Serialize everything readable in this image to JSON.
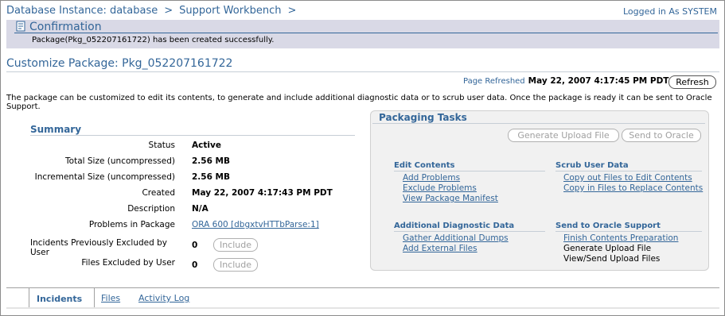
{
  "breadcrumb": {
    "items": [
      "Database Instance: database",
      "Support Workbench"
    ],
    "separator": ">"
  },
  "login_status": "Logged in As SYSTEM",
  "confirmation": {
    "title": "Confirmation",
    "message": "Package(Pkg_052207161722) has been created successfully."
  },
  "page_title": "Customize Package: Pkg_052207161722",
  "refresh": {
    "label": "Page Refreshed",
    "timestamp": "May 22, 2007 4:17:45 PM PDT",
    "button": "Refresh"
  },
  "intro_text": "The package can be customized to edit its contents, to generate and include additional diagnostic data or to scrub user data. Once the package is ready it can be sent to Oracle Support.",
  "summary": {
    "title": "Summary",
    "status": {
      "label": "Status",
      "value": "Active"
    },
    "total_size": {
      "label": "Total Size (uncompressed)",
      "value": "2.56 MB"
    },
    "incremental_size": {
      "label": "Incremental Size (uncompressed)",
      "value": "2.56 MB"
    },
    "created": {
      "label": "Created",
      "value": "May 22, 2007 4:17:43 PM PDT"
    },
    "description": {
      "label": "Description",
      "value": "N/A"
    },
    "problems": {
      "label": "Problems in Package",
      "value": "ORA 600 [dbgxtvHTTbParse:1]"
    },
    "incidents_excluded": {
      "label": "Incidents Previously Excluded by User",
      "value": "0",
      "button": "Include"
    },
    "files_excluded": {
      "label": "Files Excluded by User",
      "value": "0",
      "button": "Include"
    }
  },
  "packaging_tasks": {
    "title": "Packaging Tasks",
    "generate_button": "Generate Upload File",
    "send_button": "Send to Oracle",
    "edit_contents": {
      "heading": "Edit Contents",
      "links": [
        "Add Problems",
        "Exclude Problems",
        "View Package Manifest"
      ]
    },
    "scrub_user_data": {
      "heading": "Scrub User Data",
      "links": [
        "Copy out Files to Edit Contents",
        "Copy in Files to Replace Contents"
      ]
    },
    "additional_diagnostic": {
      "heading": "Additional Diagnostic Data",
      "links": [
        "Gather Additional Dumps",
        "Add External Files"
      ]
    },
    "send_support": {
      "heading": "Send to Oracle Support",
      "link": "Finish Contents Preparation",
      "plain": [
        "Generate Upload File",
        "View/Send Upload Files"
      ]
    }
  },
  "tabs": [
    "Incidents",
    "Files",
    "Activity Log"
  ],
  "colors": {
    "link": "#336699",
    "confirm_bg": "#d9d9e6",
    "tasks_bg": "#f1f1f1"
  }
}
